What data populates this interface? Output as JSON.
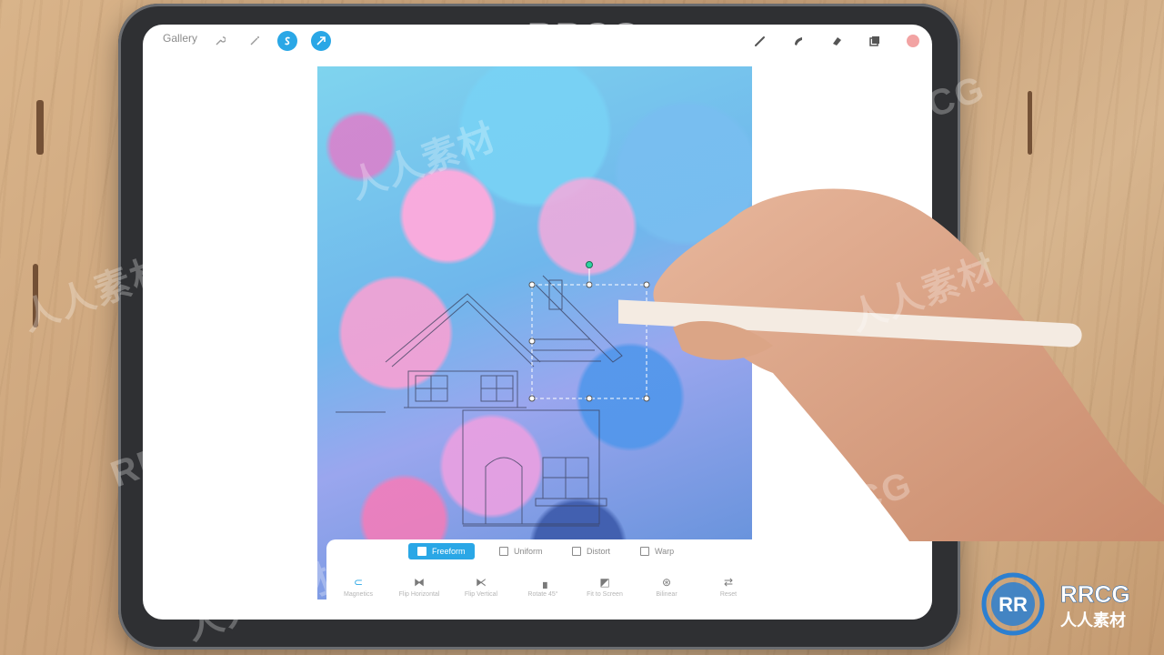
{
  "app": {
    "gallery_label": "Gallery",
    "accent_color": "#2aa7e6"
  },
  "toolbar_left": {
    "icons": [
      "wrench-icon",
      "magic-wand-icon",
      "selection-s-icon",
      "transform-arrow-icon"
    ]
  },
  "toolbar_right": {
    "icons": [
      "brush-icon",
      "smudge-icon",
      "eraser-icon",
      "layers-icon",
      "color-swatch"
    ],
    "color_swatch": "#f2a3a3"
  },
  "transform": {
    "modes": [
      {
        "label": "Freeform",
        "active": true
      },
      {
        "label": "Uniform",
        "active": false
      },
      {
        "label": "Distort",
        "active": false
      },
      {
        "label": "Warp",
        "active": false
      }
    ],
    "actions": [
      {
        "label": "Magnetics",
        "icon": "⊂"
      },
      {
        "label": "Flip Horizontal",
        "icon": "⧓"
      },
      {
        "label": "Flip Vertical",
        "icon": "⧔"
      },
      {
        "label": "Rotate 45°",
        "icon": "▗"
      },
      {
        "label": "Fit to Screen",
        "icon": "◩"
      },
      {
        "label": "Bilinear",
        "icon": "⊛"
      },
      {
        "label": "Reset",
        "icon": "⇄"
      }
    ]
  },
  "watermark": {
    "text_latin": "RRCG",
    "text_cn": "人人素材"
  }
}
